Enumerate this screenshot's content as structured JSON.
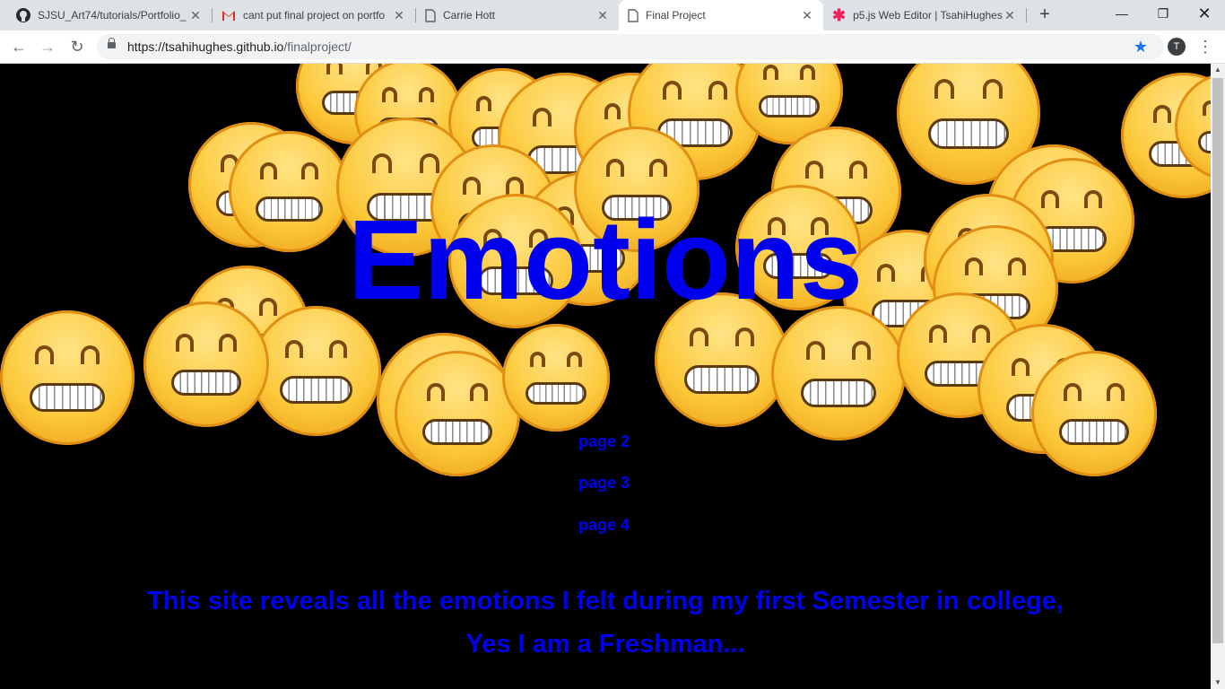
{
  "browser": {
    "tabs": [
      {
        "title": "SJSU_Art74/tutorials/Portfolio_",
        "icon": "github-icon"
      },
      {
        "title": "cant put final project on portfo",
        "icon": "gmail-icon"
      },
      {
        "title": "Carrie Hott",
        "icon": "document-icon"
      },
      {
        "title": "Final Project",
        "icon": "document-icon",
        "active": true
      },
      {
        "title": "p5.js Web Editor | TsahiHughes",
        "icon": "p5js-icon"
      }
    ],
    "address": {
      "host": "https://tsahihughes.github.io",
      "path": "/finalproject/"
    },
    "avatar_letter": "T"
  },
  "page": {
    "title": "Emotions",
    "links": [
      "page 2",
      "page 3",
      "page 4"
    ],
    "caption": "This site reveals all the emotions I felt during my first Semester in college, Yes I am a Freshman..."
  },
  "colors": {
    "link_blue": "#0000ee",
    "emoji_yellow": "#fcc83a",
    "bookmark_blue": "#1a73e8"
  }
}
